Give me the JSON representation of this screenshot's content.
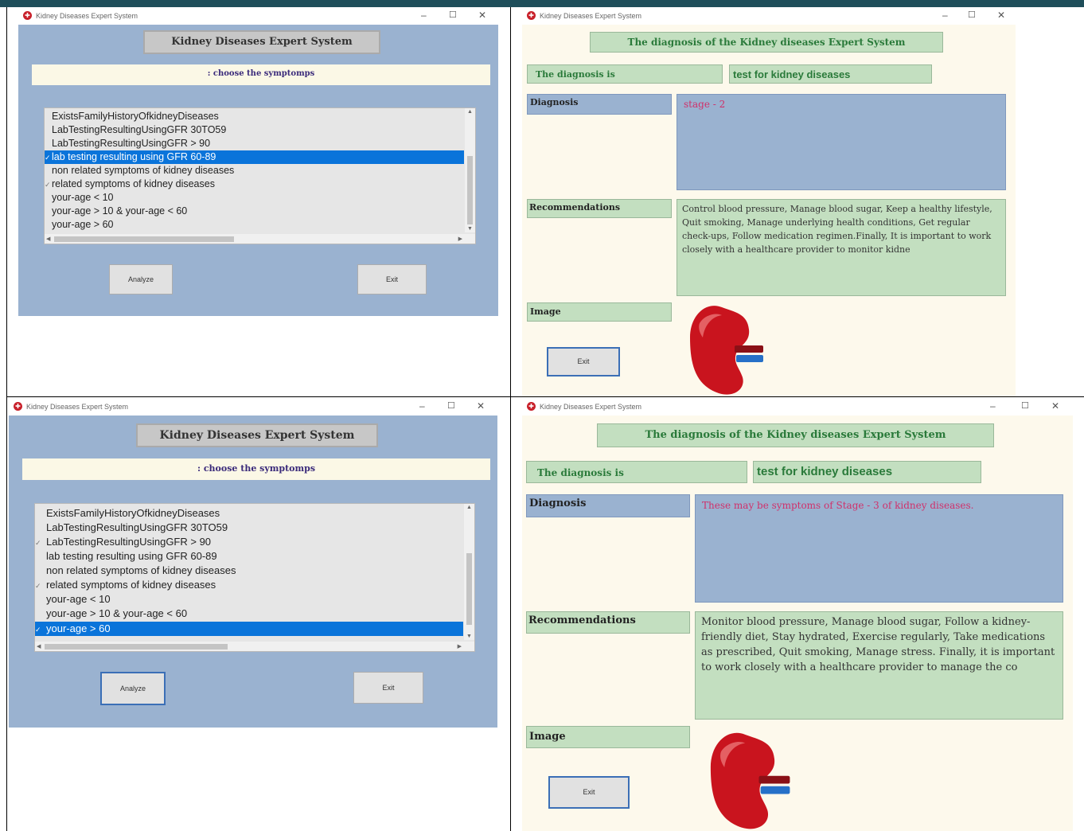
{
  "window_title": "Kidney Diseases Expert System",
  "colors": {
    "panel_blue": "#9ab2d0",
    "label_green": "#c3dfc0",
    "cream": "#fdf9ec",
    "selection": "#0a74da",
    "diagnosis_text": "#d0306a"
  },
  "input_windows": [
    {
      "header": "Kidney Diseases Expert System",
      "choose_label": ": choose the symptomps",
      "symptoms": [
        {
          "label": "ExistsFamilyHistoryOfkidneyDiseases",
          "checked": false,
          "selected": false
        },
        {
          "label": "LabTestingResultingUsingGFR 30TO59",
          "checked": false,
          "selected": false
        },
        {
          "label": "LabTestingResultingUsingGFR > 90",
          "checked": false,
          "selected": false
        },
        {
          "label": "lab testing resulting using GFR 60-89",
          "checked": true,
          "selected": true
        },
        {
          "label": "non related symptoms of kidney diseases",
          "checked": false,
          "selected": false
        },
        {
          "label": "related symptoms of kidney diseases",
          "checked": true,
          "selected": false
        },
        {
          "label": "your-age < 10",
          "checked": false,
          "selected": false
        },
        {
          "label": "your-age > 10 & your-age < 60",
          "checked": false,
          "selected": false
        },
        {
          "label": "your-age > 60",
          "checked": false,
          "selected": false
        }
      ],
      "analyze_label": "Analyze",
      "exit_label": "Exit"
    },
    {
      "header": "Kidney Diseases Expert System",
      "choose_label": ": choose the symptomps",
      "symptoms": [
        {
          "label": "ExistsFamilyHistoryOfkidneyDiseases",
          "checked": false,
          "selected": false
        },
        {
          "label": "LabTestingResultingUsingGFR 30TO59",
          "checked": false,
          "selected": false
        },
        {
          "label": "LabTestingResultingUsingGFR > 90",
          "checked": true,
          "selected": false
        },
        {
          "label": "lab testing resulting using GFR 60-89",
          "checked": false,
          "selected": false
        },
        {
          "label": "non related symptoms of kidney diseases",
          "checked": false,
          "selected": false
        },
        {
          "label": "related symptoms of kidney diseases",
          "checked": true,
          "selected": false
        },
        {
          "label": "your-age < 10",
          "checked": false,
          "selected": false
        },
        {
          "label": "your-age > 10 & your-age < 60",
          "checked": false,
          "selected": false
        },
        {
          "label": "your-age > 60",
          "checked": true,
          "selected": true
        }
      ],
      "analyze_label": "Analyze",
      "exit_label": "Exit"
    }
  ],
  "result_windows": [
    {
      "header": "The diagnosis of the Kidney diseases Expert System",
      "diagnosis_is_label": "The diagnosis is",
      "diagnosis_is_value": "test for kidney diseases",
      "diagnosis_label": "Diagnosis",
      "diagnosis_text": "stage - 2",
      "recommendations_label": "Recommendations",
      "recommendations_text": "Control blood pressure, Manage blood sugar, Keep a healthy lifestyle, Quit smoking, Manage underlying health conditions, Get regular check-ups, Follow medication regimen.Finally,  It is important to work closely with a healthcare provider to monitor kidne",
      "image_label": "Image",
      "exit_label": "Exit"
    },
    {
      "header": "The diagnosis of the Kidney diseases Expert System",
      "diagnosis_is_label": "The diagnosis is",
      "diagnosis_is_value": "test for kidney diseases",
      "diagnosis_label": "Diagnosis",
      "diagnosis_text": "These may be symptoms of Stage - 3 of kidney diseases.",
      "recommendations_label": "Recommendations",
      "recommendations_text": "Monitor blood pressure, Manage blood sugar, Follow a kidney-friendly diet, Stay hydrated, Exercise regularly, Take medications as prescribed, Quit smoking, Manage stress. Finally, it is important to work closely with a healthcare provider to manage the co",
      "image_label": "Image",
      "exit_label": "Exit"
    }
  ]
}
